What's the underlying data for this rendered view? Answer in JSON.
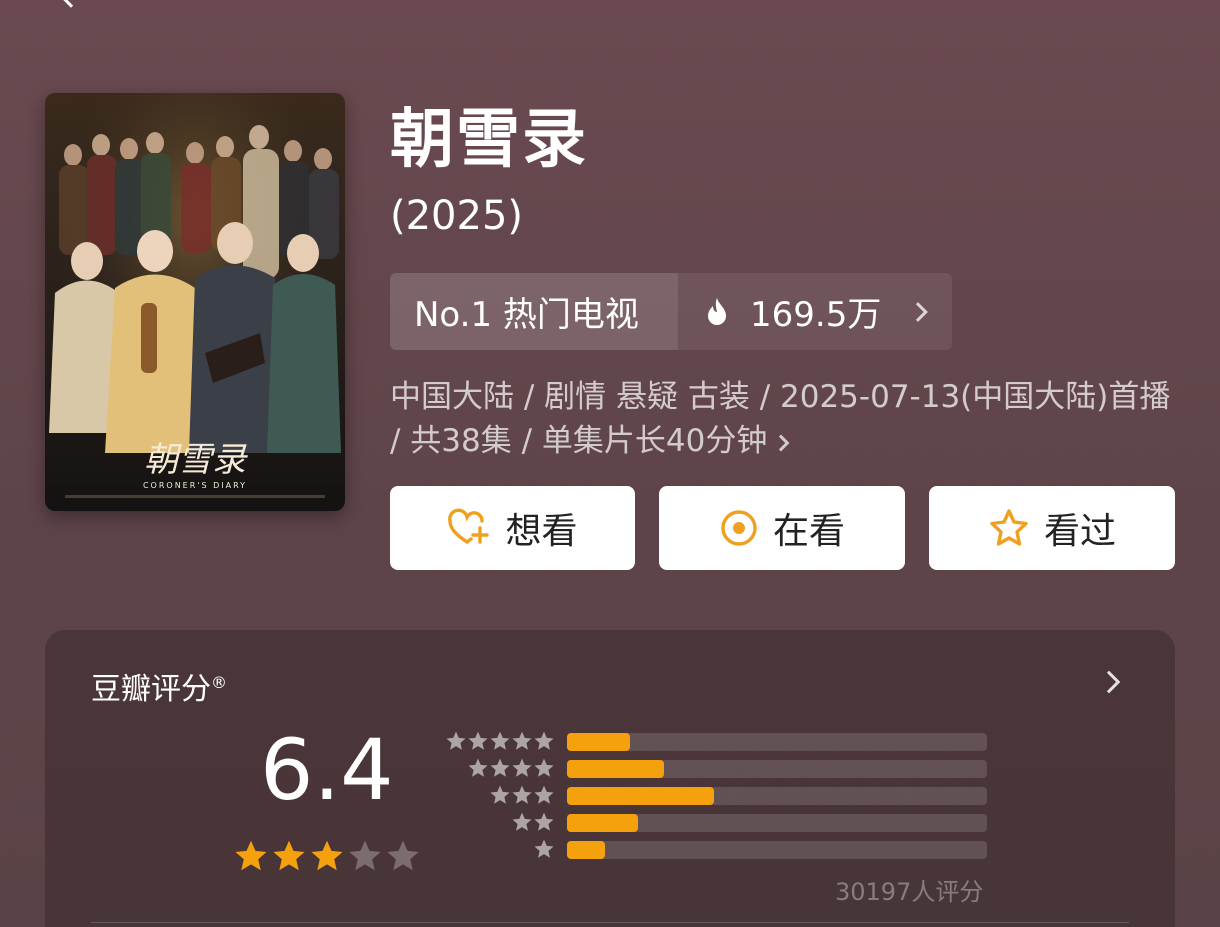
{
  "header": {
    "back_icon": "chevron-left-icon"
  },
  "poster": {
    "logo_text": "朝雪录",
    "subtitle_en": "CORONER'S DIARY"
  },
  "title": "朝雪录",
  "year": "(2025)",
  "rank": {
    "label": "No.1 热门电视",
    "heat": "169.5万",
    "heat_icon": "flame-icon",
    "chevron_icon": "chevron-right-icon"
  },
  "meta": {
    "line": "中国大陆 / 剧情 悬疑 古装 / 2025-07-13(中国大陆)首播 / 共38集 / 单集片长40分钟"
  },
  "actions": {
    "want": "想看",
    "watching": "在看",
    "watched": "看过"
  },
  "colors": {
    "accent": "#f5a10e",
    "icon_orange": "#f0a020",
    "bg": "#5e4449"
  },
  "rating": {
    "title": "豆瓣评分",
    "reg_mark": "®",
    "score": "6.4",
    "score_stars": 3,
    "votes": "30197人评分",
    "distribution": [
      {
        "stars": 5,
        "fraction": 0.15
      },
      {
        "stars": 4,
        "fraction": 0.23
      },
      {
        "stars": 3,
        "fraction": 0.35
      },
      {
        "stars": 2,
        "fraction": 0.17
      },
      {
        "stars": 1,
        "fraction": 0.09
      }
    ]
  }
}
